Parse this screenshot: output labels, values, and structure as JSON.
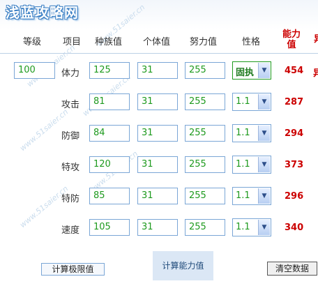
{
  "site": {
    "logo_text": "浅蓝攻略网",
    "watermark": "www.51saier.cn"
  },
  "headers": {
    "level": "等级",
    "item": "项目",
    "base": "种族值",
    "iv": "个体值",
    "ev": "努力值",
    "nature": "性格",
    "result_line1": "能力",
    "result_line2": "值",
    "edge": "异"
  },
  "level_value": "100",
  "rows": [
    {
      "label": "体力",
      "base": "125",
      "iv": "31",
      "ev": "255",
      "nature": "固执",
      "result": "454"
    },
    {
      "label": "攻击",
      "base": "81",
      "iv": "31",
      "ev": "255",
      "nature": "1.1",
      "result": "287"
    },
    {
      "label": "防御",
      "base": "84",
      "iv": "31",
      "ev": "255",
      "nature": "1.1",
      "result": "294"
    },
    {
      "label": "特攻",
      "base": "120",
      "iv": "31",
      "ev": "255",
      "nature": "1.1",
      "result": "373"
    },
    {
      "label": "特防",
      "base": "85",
      "iv": "31",
      "ev": "255",
      "nature": "1.1",
      "result": "296"
    },
    {
      "label": "速度",
      "base": "105",
      "iv": "31",
      "ev": "255",
      "nature": "1.1",
      "result": "340"
    }
  ],
  "buttons": {
    "calc_limit": "计算极限值",
    "calc_stats": "计算能力值",
    "clear": "清空数据"
  },
  "colors": {
    "value_green": "#1e9a1e",
    "result_red": "#cc0000",
    "border_blue": "#7aa6d6"
  }
}
